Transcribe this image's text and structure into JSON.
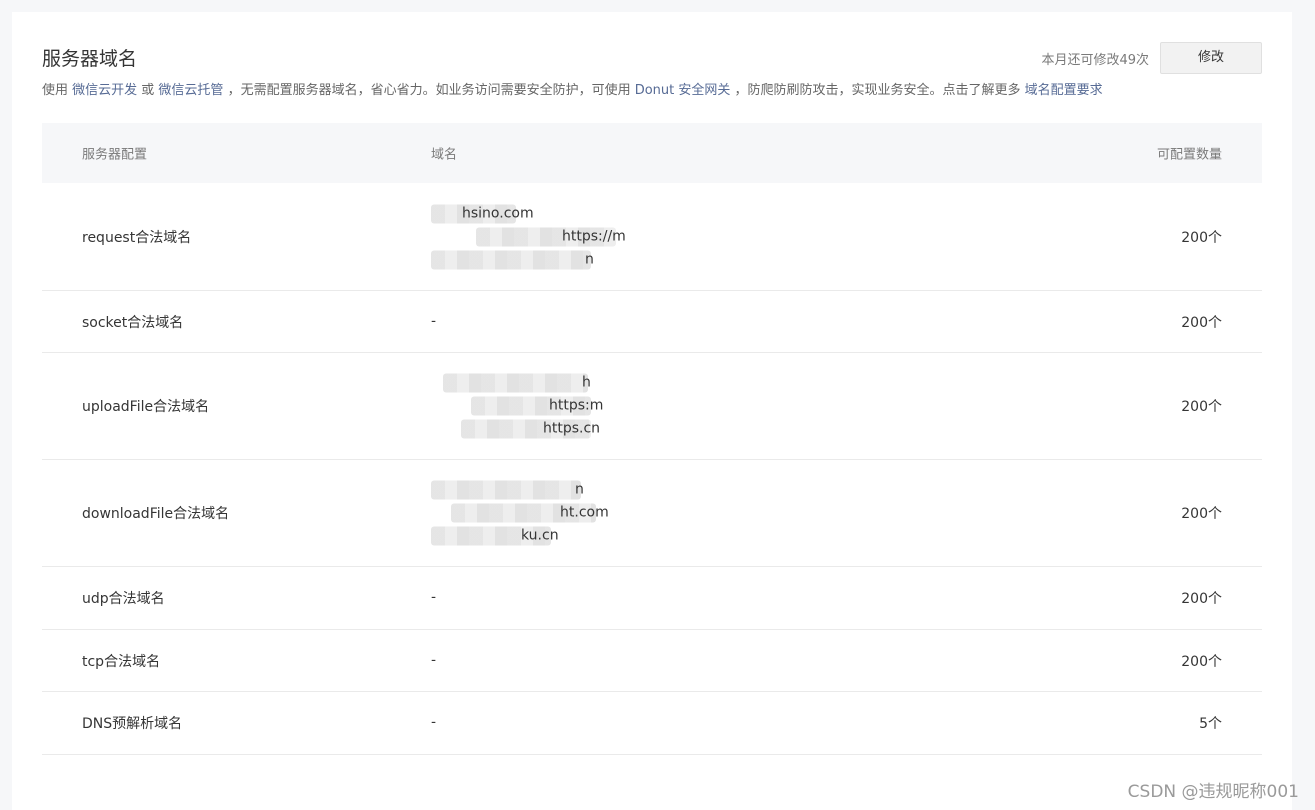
{
  "header": {
    "title": "服务器域名",
    "quota_text": "本月还可修改49次",
    "modify_label": "修改"
  },
  "description": {
    "p1": "使用 ",
    "link1": "微信云开发",
    "p2": " 或 ",
    "link2": "微信云托管",
    "p3": " ，无需配置服务器域名，省心省力。如业务访问需要安全防护，可使用 ",
    "link3": "Donut 安全网关",
    "p4": " ，防爬防刷防攻击，实现业务安全。点击了解更多 ",
    "link4": "域名配置要求"
  },
  "table": {
    "columns": [
      "服务器配置",
      "域名",
      "可配置数量"
    ],
    "rows": [
      {
        "config": "request合法域名",
        "domains": [
          "hsino.com",
          "https://m",
          "n"
        ],
        "count": "200个"
      },
      {
        "config": "socket合法域名",
        "domains": [
          "-"
        ],
        "count": "200个"
      },
      {
        "config": "uploadFile合法域名",
        "domains": [
          "h",
          "https:m",
          "https.cn"
        ],
        "count": "200个"
      },
      {
        "config": "downloadFile合法域名",
        "domains": [
          "n",
          "ht.com",
          "ku.cn"
        ],
        "count": "200个"
      },
      {
        "config": "udp合法域名",
        "domains": [
          "-"
        ],
        "count": "200个"
      },
      {
        "config": "tcp合法域名",
        "domains": [
          "-"
        ],
        "count": "200个"
      },
      {
        "config": "DNS预解析域名",
        "domains": [
          "-"
        ],
        "count": "5个"
      }
    ]
  },
  "watermark": "CSDN @违规昵称001"
}
